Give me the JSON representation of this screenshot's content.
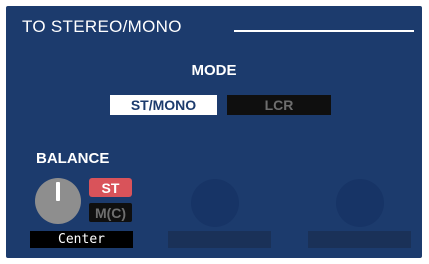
{
  "panel": {
    "title": "TO STEREO/MONO"
  },
  "mode": {
    "label": "MODE",
    "options": [
      "ST/MONO",
      "LCR"
    ],
    "selected": "ST/MONO"
  },
  "balance": {
    "label": "BALANCE",
    "st_tag": "ST",
    "mc_tag": "M(C)",
    "value": "Center",
    "knob_color": "#8e8e8e",
    "st_tag_color": "#d9535a"
  },
  "colors": {
    "panel_bg": "#1c3b6d",
    "active_button_bg": "#ffffff",
    "inactive_button_bg": "#0f0f0f"
  }
}
